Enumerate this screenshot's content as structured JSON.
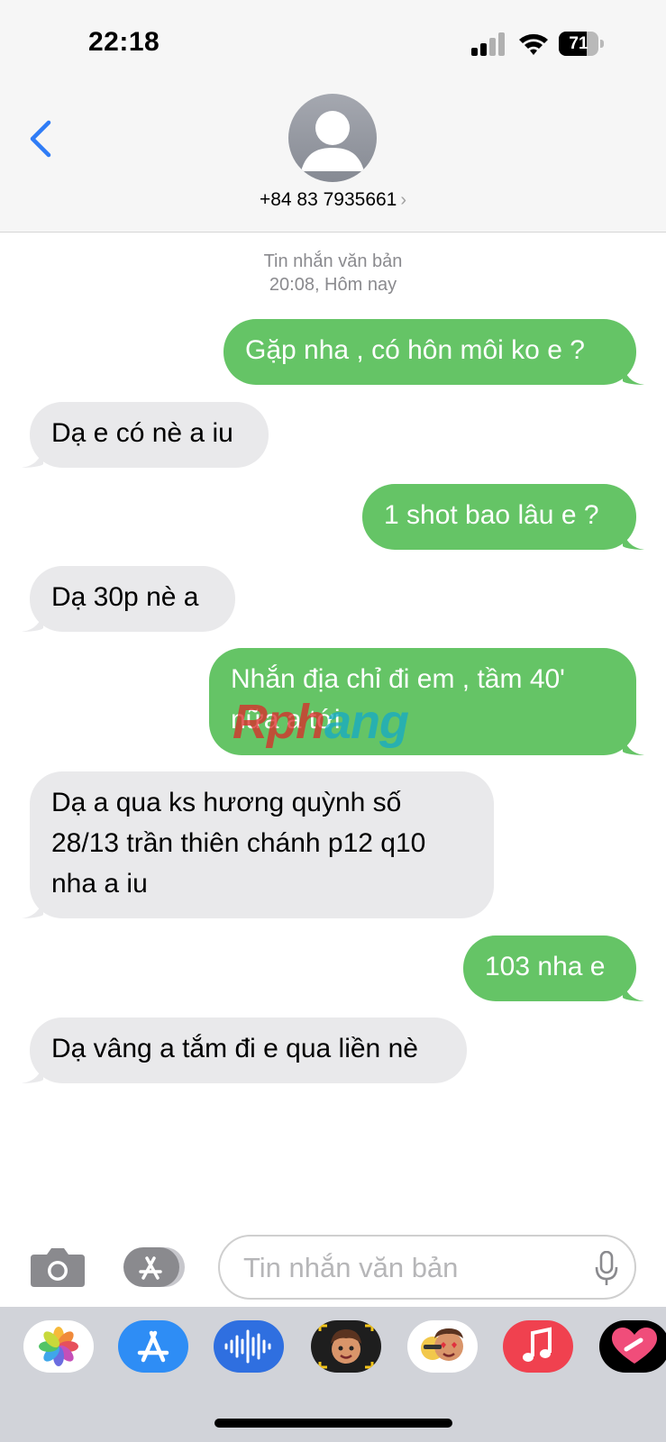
{
  "status_bar": {
    "time": "22:18",
    "battery": "71",
    "battery_level": 0.71
  },
  "header": {
    "contact": "+84 83 7935661",
    "contact_chevron": "›",
    "back_icon": "chevron-left-icon",
    "avatar_icon": "person-icon"
  },
  "thread": {
    "service_label": "Tin nhắn văn bản",
    "timestamp": "20:08, Hôm nay",
    "messages": [
      {
        "direction": "outgoing",
        "text": "Gặp nha , có hôn môi ko e ?"
      },
      {
        "direction": "incoming",
        "text": "Dạ e có nè a iu"
      },
      {
        "direction": "outgoing",
        "text": "1 shot bao lâu e ?"
      },
      {
        "direction": "incoming",
        "text": "Dạ 30p nè a"
      },
      {
        "direction": "outgoing",
        "text": "Nhắn địa chỉ đi em , tầm 40' nữa a tới"
      },
      {
        "direction": "incoming",
        "text": "Dạ a qua ks hương quỳnh số 28/13 trần thiên chánh p12 q10 nha a iu"
      },
      {
        "direction": "outgoing",
        "text": "103 nha e"
      },
      {
        "direction": "incoming",
        "text": "Dạ vâng a tắm đi e qua liền nè"
      }
    ]
  },
  "watermark": {
    "part1": "Rph",
    "part2": "ang"
  },
  "composer": {
    "placeholder": "Tin nhắn văn bản",
    "camera_icon": "camera-icon",
    "apps_icon": "app-store-icon",
    "mic_icon": "microphone-icon"
  },
  "dock_apps": [
    "photos-icon",
    "app-store-icon",
    "audio-message-icon",
    "memoji-icon",
    "animoji-stickers-icon",
    "music-icon",
    "digital-touch-icon"
  ],
  "colors": {
    "outgoing": "#65c466",
    "incoming": "#e9e9eb",
    "accent": "#2f7cf6",
    "meta": "#8a8a8e"
  }
}
